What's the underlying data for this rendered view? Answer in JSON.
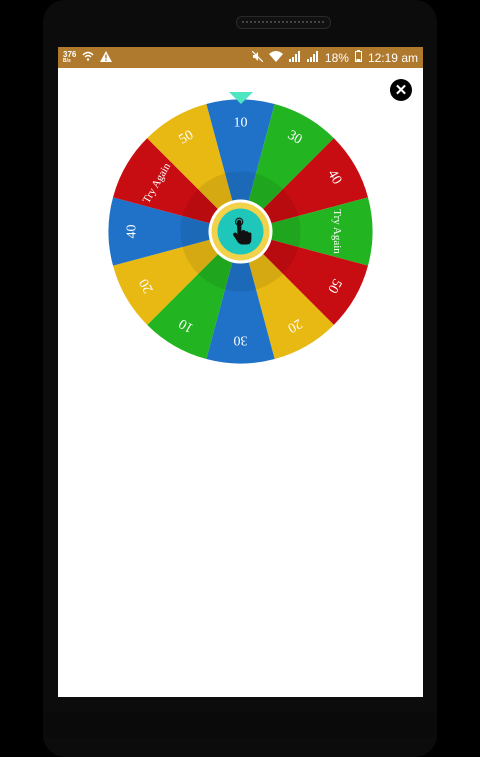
{
  "status_bar": {
    "background_color": "#b07a2e",
    "net_speed_value": "376",
    "net_speed_unit": "B/s",
    "icons_left": [
      "wifi-call-icon",
      "warning-icon"
    ],
    "icons_right": [
      "mute-icon",
      "wifi-icon",
      "signal-icon",
      "signal-icon",
      "battery-icon"
    ],
    "battery": "18%",
    "time": "12:19 am"
  },
  "close_button": {
    "icon": "close-icon"
  },
  "wheel": {
    "pointer_color": "#4de6c0",
    "center_button_icon": "tap-hand-icon",
    "center_button_color": "#1ec7b9",
    "center_ring_color": "#f2d24a",
    "segments": [
      {
        "label": "10",
        "color": "#1f72c8"
      },
      {
        "label": "30",
        "color": "#22b521"
      },
      {
        "label": "40",
        "color": "#c80d12"
      },
      {
        "label": "Try Again",
        "color": "#22b521"
      },
      {
        "label": "50",
        "color": "#c80d12"
      },
      {
        "label": "20",
        "color": "#e8b813"
      },
      {
        "label": "30",
        "color": "#1f72c8"
      },
      {
        "label": "10",
        "color": "#22b521"
      },
      {
        "label": "20",
        "color": "#e8b813"
      },
      {
        "label": "40",
        "color": "#1f72c8"
      },
      {
        "label": "Try Again",
        "color": "#c80d12"
      },
      {
        "label": "50",
        "color": "#e8b813"
      }
    ]
  }
}
